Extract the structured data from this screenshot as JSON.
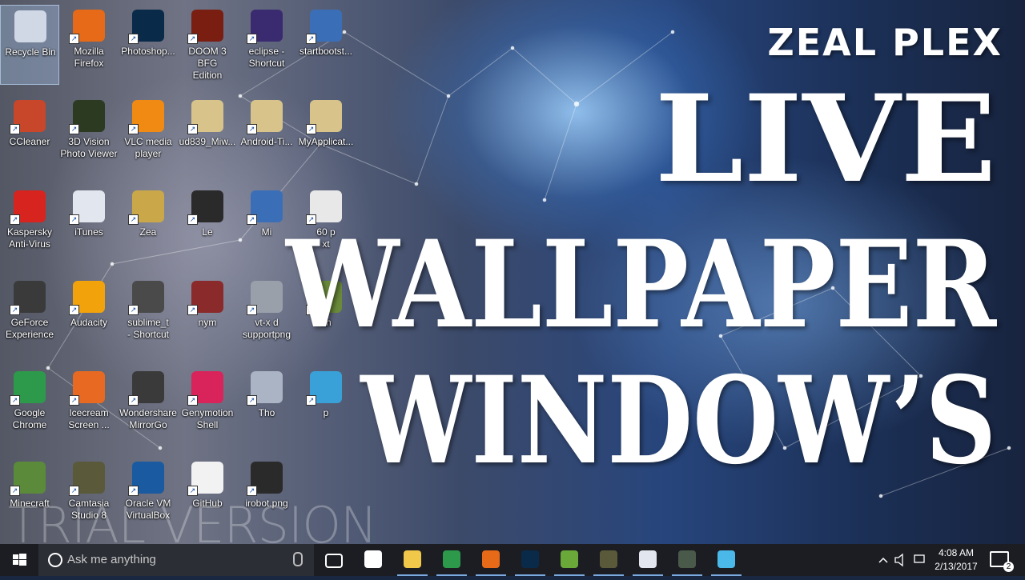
{
  "desktop": {
    "icons": [
      {
        "label": "Recycle Bin",
        "color": "#cfd8e4"
      },
      {
        "label": "Mozilla\nFirefox",
        "color": "#e66a17"
      },
      {
        "label": "Photoshop...",
        "color": "#0a2a4a"
      },
      {
        "label": "DOOM 3 BFG\nEdition",
        "color": "#7a1e12"
      },
      {
        "label": "eclipse -\nShortcut",
        "color": "#3a2a70"
      },
      {
        "label": "startbootst...",
        "color": "#3a6fb8"
      },
      {
        "label": "CCleaner",
        "color": "#c8462a"
      },
      {
        "label": "3D Vision\nPhoto Viewer",
        "color": "#2d3a22"
      },
      {
        "label": "VLC media\nplayer",
        "color": "#f08a12"
      },
      {
        "label": "ud839_Miw...",
        "color": "#d8c48a"
      },
      {
        "label": "Android-Ti...",
        "color": "#d8c48a"
      },
      {
        "label": "MyApplicat...",
        "color": "#d8c48a"
      },
      {
        "label": "Kaspersky\nAnti-Virus",
        "color": "#d8241e"
      },
      {
        "label": "iTunes",
        "color": "#e2e6ee"
      },
      {
        "label": "Zea",
        "color": "#caa84a"
      },
      {
        "label": "Le",
        "color": "#2a2a2a"
      },
      {
        "label": "Mi",
        "color": "#3a6fb8"
      },
      {
        "label": "60 p\nxt",
        "color": "#e8e8e8"
      },
      {
        "label": "GeForce\nExperience",
        "color": "#3a3a3a"
      },
      {
        "label": "Audacity",
        "color": "#f2a20a"
      },
      {
        "label": "sublime_t\n- Shortcut",
        "color": "#4a4a4a"
      },
      {
        "label": "nym",
        "color": "#8a2a2a"
      },
      {
        "label": "vt-x d\nsupportpng",
        "color": "#9aa0aa"
      },
      {
        "label": "an",
        "color": "#6a8a3a"
      },
      {
        "label": "Google\nChrome",
        "color": "#2c9a4a"
      },
      {
        "label": "Icecream\nScreen ...",
        "color": "#e86a22"
      },
      {
        "label": "Wondershare\nMirrorGo",
        "color": "#3a3a3a"
      },
      {
        "label": "Genymotion\nShell",
        "color": "#d8245a"
      },
      {
        "label": "Tho",
        "color": "#aab4c4"
      },
      {
        "label": "p",
        "color": "#3aa0d8"
      },
      {
        "label": "Minecraft",
        "color": "#5a8a3a"
      },
      {
        "label": "Camtasia\nStudio 8",
        "color": "#5a5a3a"
      },
      {
        "label": "Oracle VM\nVirtualBox",
        "color": "#1a5aa0"
      },
      {
        "label": "GitHub",
        "color": "#f2f2f2"
      },
      {
        "label": "irobot.png",
        "color": "#2a2a2a"
      }
    ]
  },
  "overlay": {
    "brand": "ZEAL PLEX",
    "line1": "LIVE",
    "line2": "WALLPAPER",
    "line3": "WINDOW’S",
    "watermark": "TRIAL VERSION"
  },
  "taskbar": {
    "search_placeholder": "Ask me anything",
    "pinned": [
      {
        "name": "task-view",
        "color": "#1b1d22"
      },
      {
        "name": "store",
        "color": "#ffffff"
      },
      {
        "name": "file-explorer",
        "color": "#f2c84a"
      },
      {
        "name": "chrome",
        "color": "#2c9a4a"
      },
      {
        "name": "firefox",
        "color": "#e66a17"
      },
      {
        "name": "photoshop",
        "color": "#0a2a4a"
      },
      {
        "name": "android-studio",
        "color": "#6aa83a"
      },
      {
        "name": "camtasia",
        "color": "#5a5a3a"
      },
      {
        "name": "itunes",
        "color": "#e2e6ee"
      },
      {
        "name": "camtasia-recorder",
        "color": "#4a5a4a"
      },
      {
        "name": "virtualbox",
        "color": "#4ab8e8"
      }
    ],
    "clock_time": "4:08 AM",
    "clock_date": "2/13/2017",
    "notification_count": "2"
  }
}
